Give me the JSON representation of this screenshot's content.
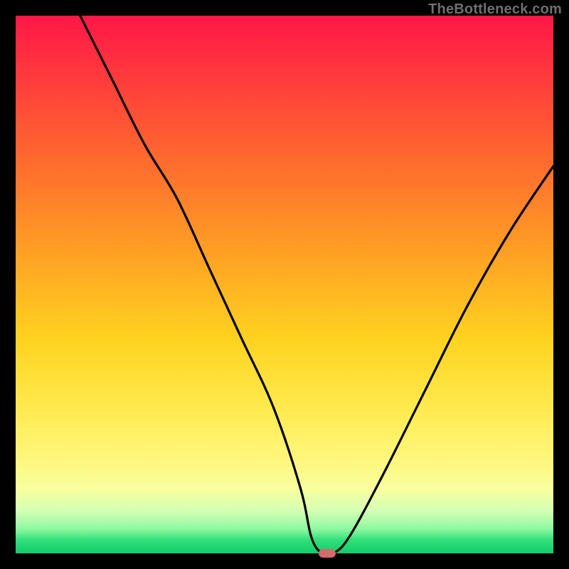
{
  "attribution": "TheBottleneck.com",
  "chart_data": {
    "type": "line",
    "title": "",
    "xlabel": "",
    "ylabel": "",
    "xlim": [
      0,
      100
    ],
    "ylim": [
      0,
      100
    ],
    "grid": false,
    "legend": false,
    "series": [
      {
        "name": "bottleneck-curve",
        "x": [
          12,
          18,
          24,
          30,
          36,
          42,
          48,
          53,
          55,
          57,
          59,
          62,
          68,
          76,
          84,
          92,
          100
        ],
        "y": [
          100,
          88,
          76,
          66,
          53,
          40,
          27,
          12,
          3,
          0,
          0,
          3,
          14,
          30,
          46,
          60,
          72
        ]
      }
    ],
    "marker": {
      "x": 58,
      "y": 0,
      "color": "#d46a6a"
    },
    "gradient_stops": [
      {
        "pos": 0,
        "color": "#ff1747"
      },
      {
        "pos": 0.12,
        "color": "#ff3c3c"
      },
      {
        "pos": 0.27,
        "color": "#ff6a2e"
      },
      {
        "pos": 0.45,
        "color": "#ffa324"
      },
      {
        "pos": 0.6,
        "color": "#ffd21f"
      },
      {
        "pos": 0.72,
        "color": "#ffe84a"
      },
      {
        "pos": 0.82,
        "color": "#fff67a"
      },
      {
        "pos": 0.88,
        "color": "#f8ff9e"
      },
      {
        "pos": 0.92,
        "color": "#d6ffb4"
      },
      {
        "pos": 0.955,
        "color": "#8cf8a0"
      },
      {
        "pos": 0.975,
        "color": "#33e07a"
      },
      {
        "pos": 1.0,
        "color": "#10cd69"
      }
    ]
  }
}
